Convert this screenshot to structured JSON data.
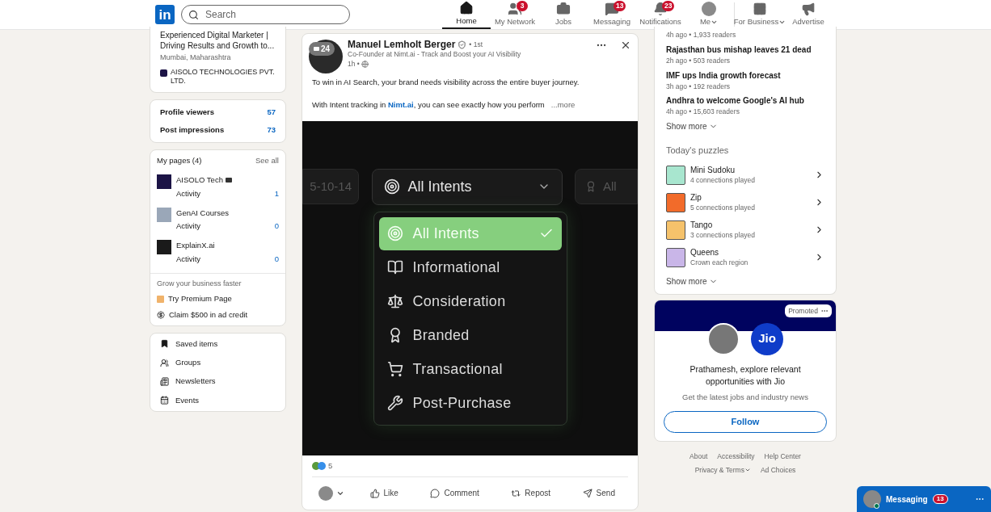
{
  "nav": {
    "logo": "in",
    "search": {
      "placeholder": "Search"
    },
    "items": [
      {
        "label": "Home",
        "kind": "icon",
        "selected": true
      },
      {
        "label": "My Network",
        "kind": "icon",
        "badge": "3",
        "selected": false
      },
      {
        "label": "Jobs",
        "kind": "icon",
        "selected": false
      },
      {
        "label": "Messaging",
        "kind": "icon",
        "badge": "13",
        "selected": false
      },
      {
        "label": "Notifications",
        "kind": "icon",
        "badge": "23",
        "selected": false
      },
      {
        "label": "Me",
        "kind": "avatar",
        "menu": true,
        "selected": false
      },
      {
        "label": "For Business",
        "kind": "icon",
        "menu": true,
        "selected": false
      },
      {
        "label": "Advertise",
        "kind": "icon",
        "selected": false
      }
    ]
  },
  "left": {
    "profile": {
      "headline": "Experienced Digital Marketer | Driving Results and Growth to...",
      "location": "Mumbai, Maharashtra",
      "company": "AISOLO TECHNOLOGIES PVT. LTD."
    },
    "stats": [
      {
        "label": "Profile viewers",
        "value": "57"
      },
      {
        "label": "Post impressions",
        "value": "73"
      }
    ],
    "pages": {
      "title": "My pages (4)",
      "see_all": "See all",
      "items": [
        {
          "name": "AISOLO Tech",
          "sub": "Activity",
          "count": "1",
          "linked": true
        },
        {
          "name": "GenAI Courses",
          "sub": "Activity",
          "count": "0",
          "linked": false
        },
        {
          "name": "ExplainX.ai",
          "sub": "Activity",
          "count": "0",
          "linked": false
        }
      ]
    },
    "grow": {
      "title": "Grow your business faster",
      "items": [
        "Try Premium Page",
        "Claim $500 in ad credit"
      ]
    },
    "shortcuts": [
      "Saved items",
      "Groups",
      "Newsletters",
      "Events"
    ]
  },
  "post": {
    "badge": "24",
    "author": "Manuel Lemholt Berger",
    "degree": "• 1st",
    "subtitle": "Co-Founder at Nimt.ai - Track and Boost your AI Visibility",
    "time": "1h •",
    "text1": "To win in AI Search, your brand needs visibility across the entire buyer journey.",
    "text2_before": "With Intent tracking in ",
    "text2_link": "Nimt.ai",
    "text2_after": ", you can see exactly how you perform",
    "more": "...more",
    "image": {
      "left_chip": "5-10-14",
      "right_chip": "All",
      "select": "All Intents",
      "options": [
        {
          "label": "All Intents",
          "selected": true
        },
        {
          "label": "Informational",
          "selected": false
        },
        {
          "label": "Consideration",
          "selected": false
        },
        {
          "label": "Branded",
          "selected": false
        },
        {
          "label": "Transactional",
          "selected": false
        },
        {
          "label": "Post-Purchase",
          "selected": false
        }
      ]
    },
    "reactions": "5",
    "actions": [
      "Like",
      "Comment",
      "Repost",
      "Send"
    ]
  },
  "right": {
    "news": [
      {
        "meta": "4h ago • 1,933 readers"
      },
      {
        "title": "Rajasthan bus mishap leaves 21 dead",
        "meta": "2h ago • 503 readers"
      },
      {
        "title": "IMF ups India growth forecast",
        "meta": "3h ago • 192 readers"
      },
      {
        "title": "Andhra to welcome Google's AI hub",
        "meta": "4h ago • 15,603 readers"
      }
    ],
    "show_more": "Show more",
    "puzzles_title": "Today's puzzles",
    "puzzles": [
      {
        "name": "Mini Sudoku",
        "sub": "4 connections played"
      },
      {
        "name": "Zip",
        "sub": "5 connections played"
      },
      {
        "name": "Tango",
        "sub": "3 connections played"
      },
      {
        "name": "Queens",
        "sub": "Crown each region"
      }
    ],
    "puzzles_more": "Show more",
    "ad": {
      "badge": "Promoted",
      "logo": "Jio",
      "headline": "Prathamesh, explore relevant opportunities with Jio",
      "sub": "Get the latest jobs and industry news",
      "button": "Follow"
    },
    "footer": [
      "About",
      "Accessibility",
      "Help Center",
      "Privacy & Terms",
      "Ad Choices"
    ]
  },
  "messaging": {
    "label": "Messaging",
    "badge": "13"
  }
}
